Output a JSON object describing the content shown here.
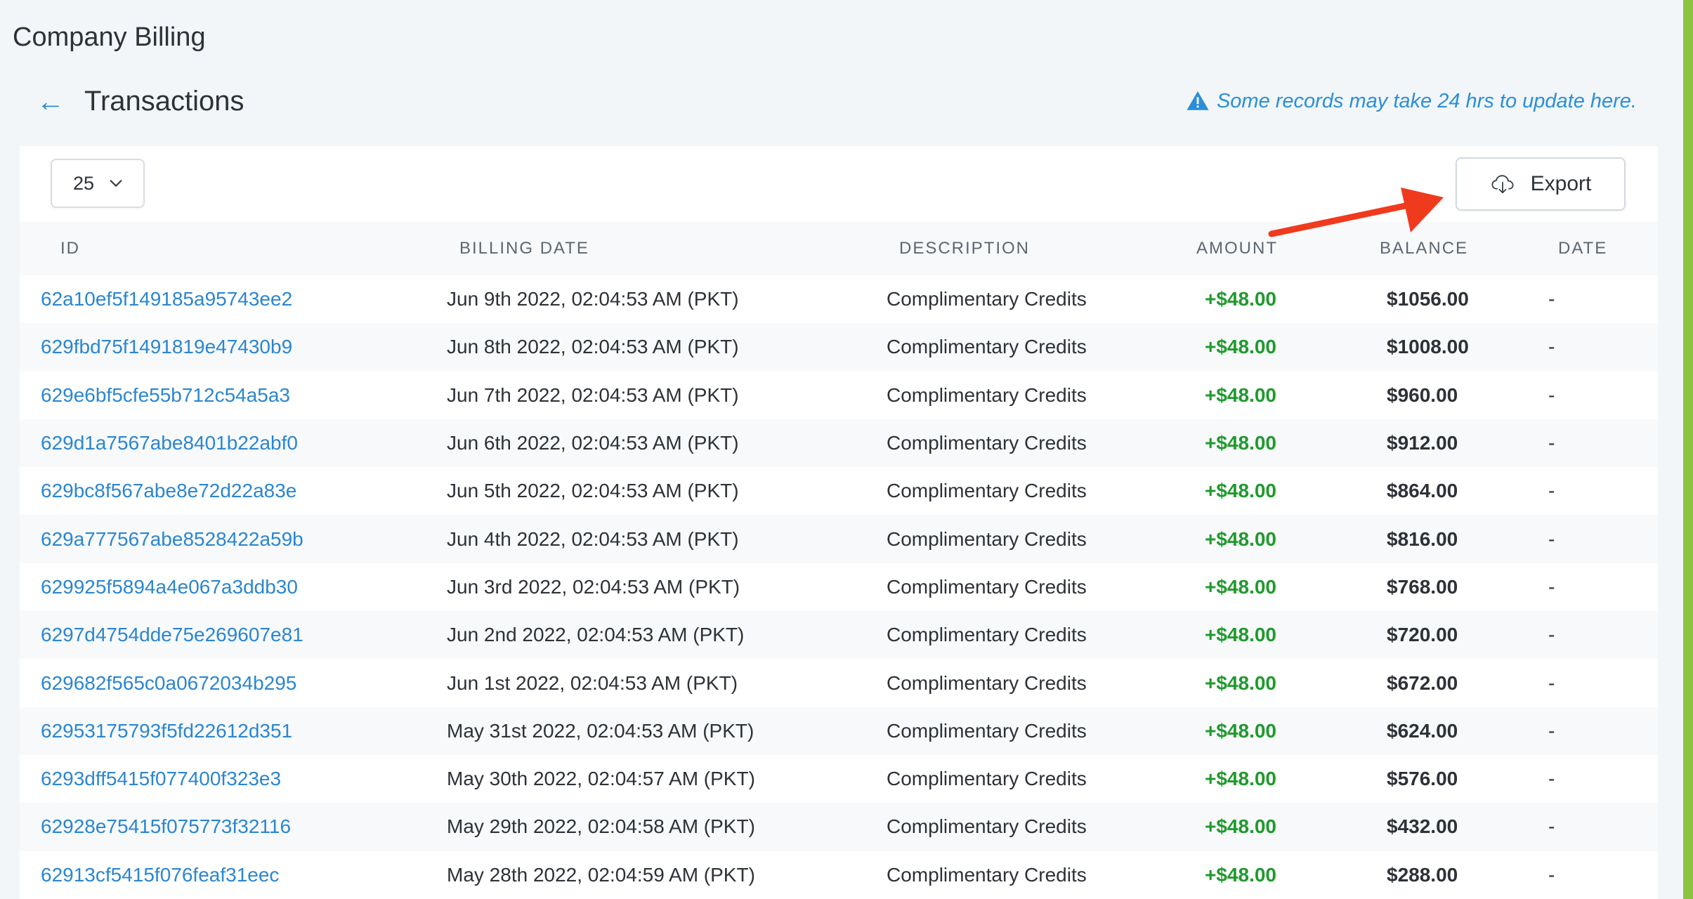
{
  "app": {
    "title": "Company Billing"
  },
  "header": {
    "title": "Transactions",
    "notice": "Some records may take 24 hrs to update here."
  },
  "toolbar": {
    "page_size": "25",
    "export_label": "Export"
  },
  "table": {
    "columns": [
      "ID",
      "BILLING DATE",
      "DESCRIPTION",
      "AMOUNT",
      "BALANCE",
      "DATE"
    ],
    "rows": [
      {
        "id": "62a10ef5f149185a95743ee2",
        "billing_date": "Jun 9th 2022, 02:04:53 AM (PKT)",
        "description": "Complimentary Credits",
        "amount": "+$48.00",
        "balance": "$1056.00",
        "date": "-"
      },
      {
        "id": "629fbd75f1491819e47430b9",
        "billing_date": "Jun 8th 2022, 02:04:53 AM (PKT)",
        "description": "Complimentary Credits",
        "amount": "+$48.00",
        "balance": "$1008.00",
        "date": "-"
      },
      {
        "id": "629e6bf5cfe55b712c54a5a3",
        "billing_date": "Jun 7th 2022, 02:04:53 AM (PKT)",
        "description": "Complimentary Credits",
        "amount": "+$48.00",
        "balance": "$960.00",
        "date": "-"
      },
      {
        "id": "629d1a7567abe8401b22abf0",
        "billing_date": "Jun 6th 2022, 02:04:53 AM (PKT)",
        "description": "Complimentary Credits",
        "amount": "+$48.00",
        "balance": "$912.00",
        "date": "-"
      },
      {
        "id": "629bc8f567abe8e72d22a83e",
        "billing_date": "Jun 5th 2022, 02:04:53 AM (PKT)",
        "description": "Complimentary Credits",
        "amount": "+$48.00",
        "balance": "$864.00",
        "date": "-"
      },
      {
        "id": "629a777567abe8528422a59b",
        "billing_date": "Jun 4th 2022, 02:04:53 AM (PKT)",
        "description": "Complimentary Credits",
        "amount": "+$48.00",
        "balance": "$816.00",
        "date": "-"
      },
      {
        "id": "629925f5894a4e067a3ddb30",
        "billing_date": "Jun 3rd 2022, 02:04:53 AM (PKT)",
        "description": "Complimentary Credits",
        "amount": "+$48.00",
        "balance": "$768.00",
        "date": "-"
      },
      {
        "id": "6297d4754dde75e269607e81",
        "billing_date": "Jun 2nd 2022, 02:04:53 AM (PKT)",
        "description": "Complimentary Credits",
        "amount": "+$48.00",
        "balance": "$720.00",
        "date": "-"
      },
      {
        "id": "629682f565c0a0672034b295",
        "billing_date": "Jun 1st 2022, 02:04:53 AM (PKT)",
        "description": "Complimentary Credits",
        "amount": "+$48.00",
        "balance": "$672.00",
        "date": "-"
      },
      {
        "id": "62953175793f5fd22612d351",
        "billing_date": "May 31st 2022, 02:04:53 AM (PKT)",
        "description": "Complimentary Credits",
        "amount": "+$48.00",
        "balance": "$624.00",
        "date": "-"
      },
      {
        "id": "6293dff5415f077400f323e3",
        "billing_date": "May 30th 2022, 02:04:57 AM (PKT)",
        "description": "Complimentary Credits",
        "amount": "+$48.00",
        "balance": "$576.00",
        "date": "-"
      },
      {
        "id": "62928e75415f075773f32116",
        "billing_date": "May 29th 2022, 02:04:58 AM (PKT)",
        "description": "Complimentary Credits",
        "amount": "+$48.00",
        "balance": "$432.00",
        "date": "-"
      },
      {
        "id": "62913cf5415f076feaf31eec",
        "billing_date": "May 28th 2022, 02:04:59 AM (PKT)",
        "description": "Complimentary Credits",
        "amount": "+$48.00",
        "balance": "$288.00",
        "date": "-"
      }
    ]
  },
  "icons": {
    "back": "arrow-left-icon",
    "notice": "warning-triangle-icon",
    "dropdown": "chevron-down-icon",
    "export": "cloud-download-icon"
  },
  "colors": {
    "link": "#2b86cf",
    "amount_positive": "#1f9a2c",
    "annotation_arrow": "#f03a1e",
    "accent_bar": "#8cc43f",
    "background": "#f2f6f9"
  }
}
